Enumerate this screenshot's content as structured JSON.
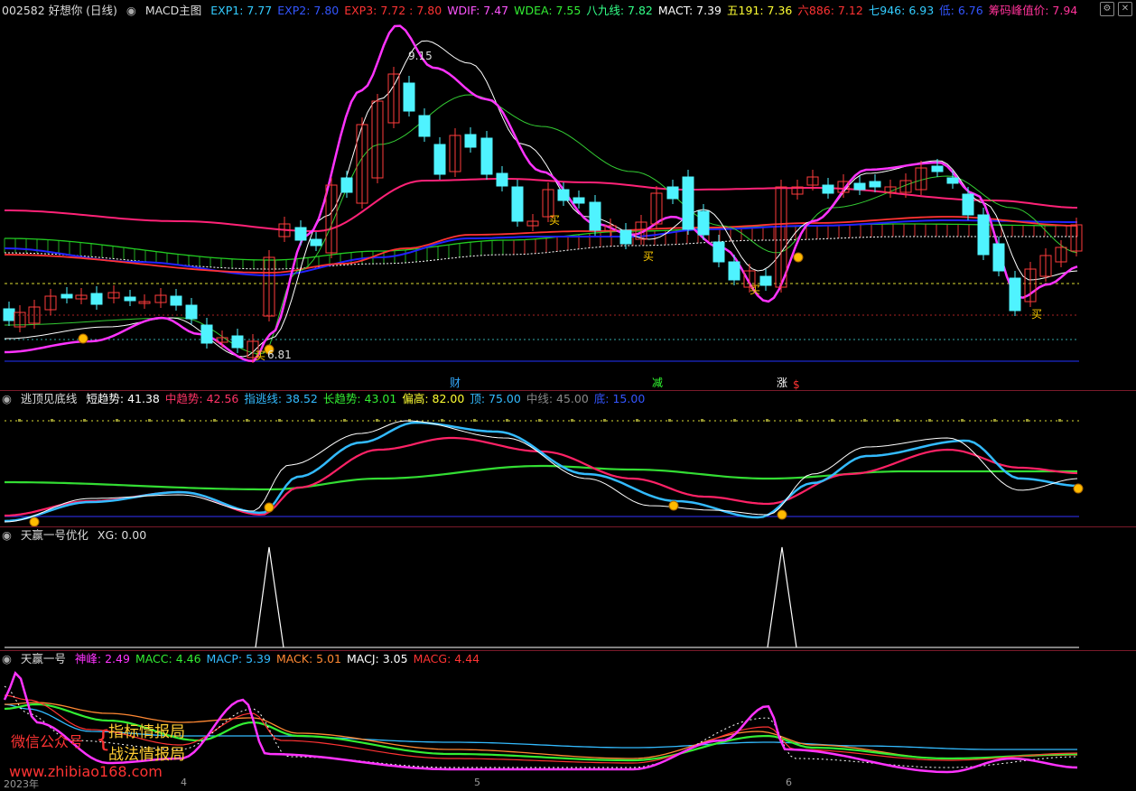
{
  "colors": {
    "bg": "#000000",
    "up": "#ff3c3c",
    "down": "#4ff3ff",
    "magenta": "#ff33ff",
    "white": "#ffffff",
    "green": "#33dd33",
    "pink": "#ff2277",
    "blue": "#2222ff",
    "cyan": "#33aaff",
    "yellow": "#ffff33",
    "gold": "#ffcc00"
  },
  "main": {
    "stock": "002582 好想你 (日线)",
    "indicator": "MACD主图",
    "items": [
      {
        "label": "EXP1: 7.77",
        "color": "#33ccff"
      },
      {
        "label": "EXP2: 7.80",
        "color": "#3355ff"
      },
      {
        "label": "EXP3: 7.72 : 7.80",
        "color": "#ff3333"
      },
      {
        "label": "WDIF: 7.47",
        "color": "#ff55ff"
      },
      {
        "label": "WDEA: 7.55",
        "color": "#33ee33"
      },
      {
        "label": "八九线: 7.82",
        "color": "#33ff88"
      },
      {
        "label": "MACT: 7.39",
        "color": "#ffffff"
      },
      {
        "label": "五191: 7.36",
        "color": "#ffff33"
      },
      {
        "label": "六886: 7.12",
        "color": "#ff3333"
      },
      {
        "label": "七946: 6.93",
        "color": "#33ccff"
      },
      {
        "label": "低: 6.76",
        "color": "#3355ff"
      },
      {
        "label": "筹码峰值价: 7.94",
        "color": "#ff3399"
      }
    ],
    "high_label": "9.15",
    "low_label": "6.81",
    "buy_label": "买",
    "buy_markers": [
      "买",
      "买",
      "买",
      "买",
      "买"
    ],
    "events": [
      {
        "label": "财",
        "color": "#33aaff"
      },
      {
        "label": "减",
        "color": "#33ff33"
      },
      {
        "label": "涨",
        "color": "#ffffff"
      },
      {
        "label": "$",
        "color": "#ff3333"
      }
    ]
  },
  "pane2": {
    "title": "逃顶见底线",
    "items": [
      {
        "label": "短趋势: 41.38",
        "color": "#ffffff"
      },
      {
        "label": "中趋势: 42.56",
        "color": "#ff3366"
      },
      {
        "label": "指逃线: 38.52",
        "color": "#33bbff"
      },
      {
        "label": "长趋势: 43.01",
        "color": "#33ee33"
      },
      {
        "label": "偏高: 82.00",
        "color": "#ffff33"
      },
      {
        "label": "顶: 75.00",
        "color": "#33bbff"
      },
      {
        "label": "中线: 45.00",
        "color": "#888888"
      },
      {
        "label": "底: 15.00",
        "color": "#3355ff"
      }
    ]
  },
  "pane3": {
    "title": "天赢一号优化",
    "items": [
      {
        "label": "XG: 0.00",
        "color": "#dddddd"
      }
    ]
  },
  "pane4": {
    "title": "天赢一号",
    "items": [
      {
        "label": "神峰: 2.49",
        "color": "#ff33ff"
      },
      {
        "label": "MACC: 4.46",
        "color": "#33ee33"
      },
      {
        "label": "MACP: 5.39",
        "color": "#33bbff"
      },
      {
        "label": "MACK: 5.01",
        "color": "#ff8833"
      },
      {
        "label": "MACJ: 3.05",
        "color": "#ffffff"
      },
      {
        "label": "MACG: 4.44",
        "color": "#ff3333"
      }
    ]
  },
  "xaxis": {
    "labels": [
      "2023年",
      "4",
      "5",
      "6"
    ]
  },
  "watermark": {
    "left": "微信公众号",
    "line1": "指标情报局",
    "line2": "战法情报局",
    "url": "www.zhibiao168.com"
  }
}
